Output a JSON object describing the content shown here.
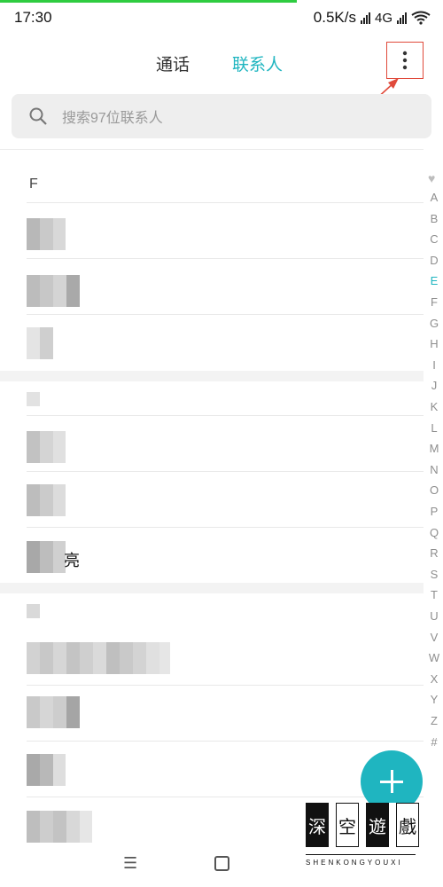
{
  "status_bar": {
    "time": "17:30",
    "net_speed": "0.5K/s",
    "network": "4G"
  },
  "tabs": {
    "calls": "通话",
    "contacts": "联系人"
  },
  "search": {
    "placeholder": "搜索97位联系人"
  },
  "contacts": {
    "section_letter": "F",
    "visible_text_suffix": "亮"
  },
  "alpha_index": {
    "letters": [
      "A",
      "B",
      "C",
      "D",
      "E",
      "F",
      "G",
      "H",
      "I",
      "J",
      "K",
      "L",
      "M",
      "N",
      "O",
      "P",
      "Q",
      "R",
      "S",
      "T",
      "U",
      "V",
      "W",
      "X",
      "Y",
      "Z",
      "#"
    ],
    "active": "E"
  },
  "watermark": {
    "chars": [
      "深",
      "空",
      "遊",
      "戲"
    ],
    "latin": "SHENKONGYOUXI"
  },
  "colors": {
    "accent": "#1fb5c0",
    "annotation": "#e04a3b"
  },
  "icons": {
    "menu": "more-vert-icon",
    "search": "search-icon",
    "add": "plus-icon"
  }
}
